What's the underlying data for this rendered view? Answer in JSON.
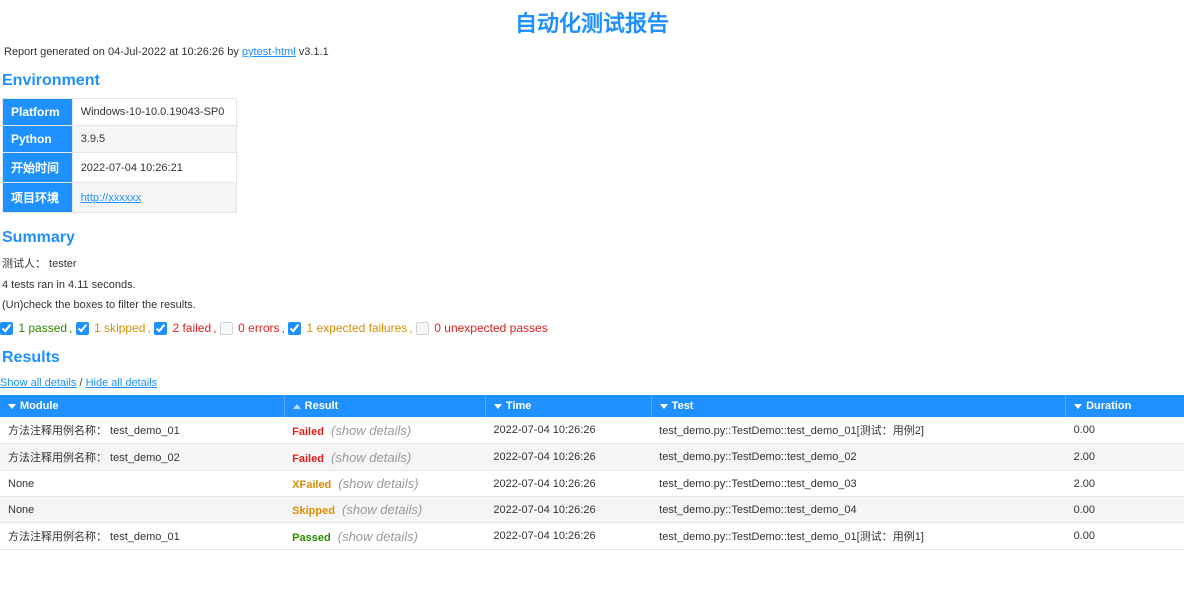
{
  "title": "自动化测试报告",
  "generated": {
    "prefix": "Report generated on 04-Jul-2022 at 10:26:26 by ",
    "link_text": "pytest-html",
    "version": " v3.1.1"
  },
  "sections": {
    "environment": "Environment",
    "summary": "Summary",
    "results": "Results"
  },
  "env": {
    "rows": [
      {
        "key": "Platform",
        "value": "Windows-10-10.0.19043-SP0",
        "link": false
      },
      {
        "key": "Python",
        "value": "3.9.5",
        "link": false
      },
      {
        "key": "开始时间",
        "value": "2022-07-04 10:26:21",
        "link": false
      },
      {
        "key": "项目环境",
        "value": "http://xxxxxx",
        "link": true
      }
    ]
  },
  "summary": {
    "tester_line": "测试人： tester",
    "run_line": "4 tests ran in 4.11 seconds.",
    "hint_line": "(Un)check the boxes to filter the results."
  },
  "filters": {
    "passed": {
      "label": "1 passed",
      "checked": true,
      "enabled": true
    },
    "skipped": {
      "label": "1 skipped",
      "checked": true,
      "enabled": true
    },
    "failed": {
      "label": "2 failed",
      "checked": true,
      "enabled": true
    },
    "errors": {
      "label": "0 errors",
      "checked": false,
      "enabled": false
    },
    "xfail": {
      "label": "1 expected failures",
      "checked": true,
      "enabled": true
    },
    "xpass": {
      "label": "0 unexpected passes",
      "checked": false,
      "enabled": false
    },
    "comma": ", "
  },
  "detail_links": {
    "show": "Show all details",
    "hide": "Hide all details",
    "sep": " / "
  },
  "columns": {
    "module": "Module",
    "result": "Result",
    "time": "Time",
    "test": "Test",
    "duration": "Duration"
  },
  "show_details_label": "(show details)",
  "rows": [
    {
      "module": "方法注释用例名称： test_demo_01",
      "result": "Failed",
      "result_class": "st-failed",
      "time": "2022-07-04 10:26:26",
      "test": "test_demo.py::TestDemo::test_demo_01[测试：用例2]",
      "duration": "0.00"
    },
    {
      "module": "方法注释用例名称： test_demo_02",
      "result": "Failed",
      "result_class": "st-failed",
      "time": "2022-07-04 10:26:26",
      "test": "test_demo.py::TestDemo::test_demo_02",
      "duration": "2.00"
    },
    {
      "module": "None",
      "result": "XFailed",
      "result_class": "st-xfailed",
      "time": "2022-07-04 10:26:26",
      "test": "test_demo.py::TestDemo::test_demo_03",
      "duration": "2.00"
    },
    {
      "module": "None",
      "result": "Skipped",
      "result_class": "st-skipped",
      "time": "2022-07-04 10:26:26",
      "test": "test_demo.py::TestDemo::test_demo_04",
      "duration": "0.00"
    },
    {
      "module": "方法注释用例名称： test_demo_01",
      "result": "Passed",
      "result_class": "st-passed",
      "time": "2022-07-04 10:26:26",
      "test": "test_demo.py::TestDemo::test_demo_01[测试：用例1]",
      "duration": "0.00"
    }
  ]
}
